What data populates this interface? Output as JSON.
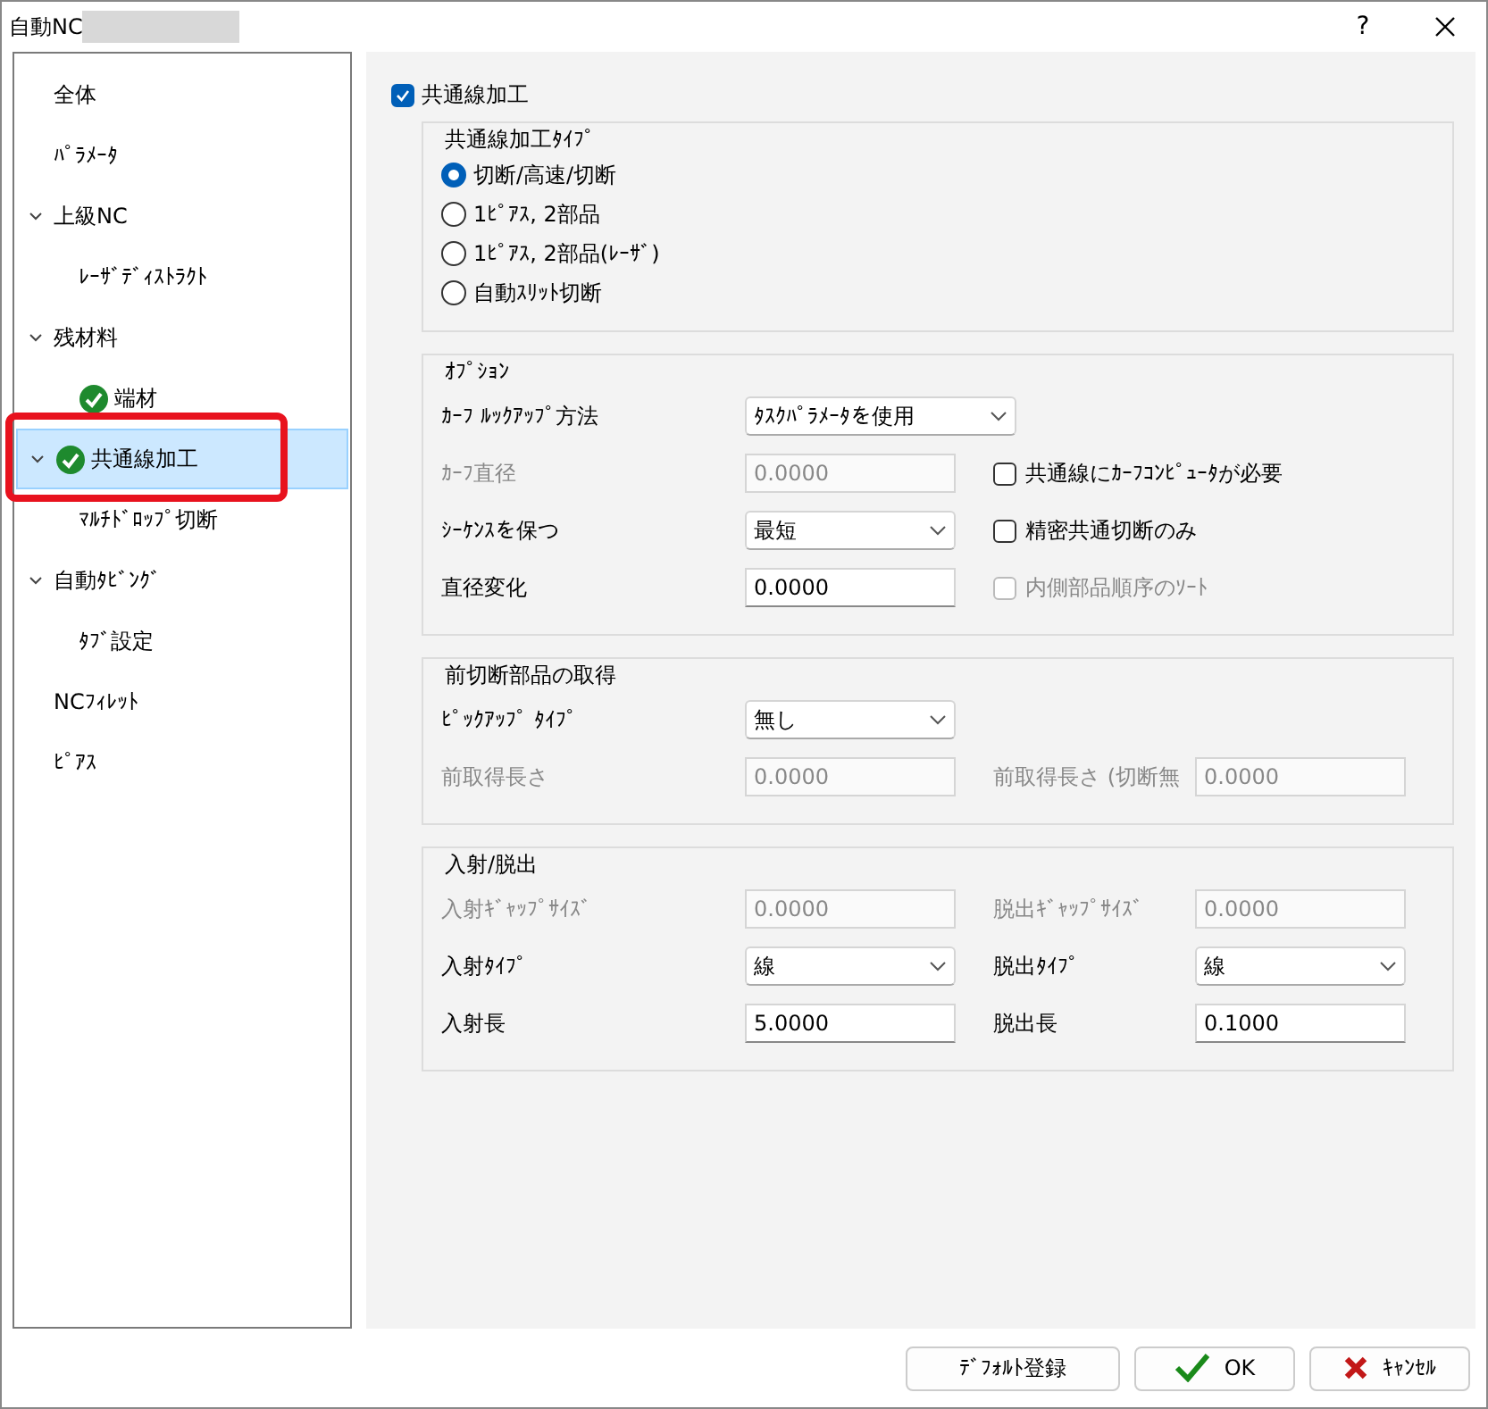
{
  "window": {
    "title": "自動NC",
    "redacted": true,
    "help": "?"
  },
  "tree": [
    {
      "label": "全体",
      "selected": false
    },
    {
      "label": "ﾊﾟﾗﾒｰﾀ",
      "selected": false
    },
    {
      "label": "上級NC",
      "selected": false,
      "expanded": true,
      "children": [
        {
          "label": "ﾚｰｻﾞﾃﾞｨｽﾄﾗｸﾄ",
          "selected": false
        }
      ]
    },
    {
      "label": "残材料",
      "selected": false,
      "expanded": true,
      "children": [
        {
          "label": "端材",
          "selected": false,
          "done": true
        }
      ]
    },
    {
      "label": "共通線加工",
      "selected": true,
      "done": true,
      "annotated": true,
      "expanded": true,
      "children": [
        {
          "label": "ﾏﾙﾁﾄﾞﾛｯﾌﾟ切断",
          "selected": false
        }
      ]
    },
    {
      "label": "自動ﾀﾋﾞﾝｸﾞ",
      "selected": false,
      "expanded": true,
      "children": [
        {
          "label": "ﾀﾌﾞ設定",
          "selected": false
        }
      ]
    },
    {
      "label": "NCﾌｨﾚｯﾄ",
      "selected": false
    },
    {
      "label": "ﾋﾟｱｽ",
      "selected": false
    }
  ],
  "enable": {
    "label": "共通線加工",
    "checked": true
  },
  "groups": [
    {
      "title": "共通線加工ﾀｲﾌﾟ",
      "kind": "radios",
      "options": [
        {
          "label": "切断/高速/切断",
          "selected": true
        },
        {
          "label": "1ﾋﾟｱｽ, 2部品",
          "selected": false
        },
        {
          "label": "1ﾋﾟｱｽ, 2部品(ﾚｰｻﾞ)",
          "selected": false
        },
        {
          "label": "自動ｽﾘｯﾄ切断",
          "selected": false
        }
      ]
    },
    {
      "title": "ｵﾌﾟｼｮﾝ",
      "kind": "form",
      "rows": [
        [
          {
            "kind": "select",
            "label": "ｶｰﾌ ﾙｯｸｱｯﾌﾟ方法",
            "value": "ﾀｽｸﾊﾟﾗﾒｰﾀを使用",
            "disabled": false
          }
        ],
        [
          {
            "kind": "input",
            "label": "ｶｰﾌ直径",
            "value": "0.0000",
            "disabled": true
          },
          {
            "kind": "checkbox",
            "label": "共通線にｶｰﾌｺﾝﾋﾟｭｰﾀが必要",
            "checked": false,
            "disabled": false
          }
        ],
        [
          {
            "kind": "select",
            "label": "ｼｰｹﾝｽを保つ",
            "value": "最短",
            "disabled": false
          },
          {
            "kind": "checkbox",
            "label": "精密共通切断のみ",
            "checked": false,
            "disabled": false
          }
        ],
        [
          {
            "kind": "input",
            "label": "直径変化",
            "value": "0.0000",
            "disabled": false
          },
          {
            "kind": "checkbox",
            "label": "内側部品順序のｿｰﾄ",
            "checked": false,
            "disabled": true
          }
        ]
      ]
    },
    {
      "title": "前切断部品の取得",
      "kind": "form",
      "rows": [
        [
          {
            "kind": "select",
            "label": "ﾋﾟｯｸｱｯﾌﾟ ﾀｲﾌﾟ",
            "value": "無し",
            "disabled": false
          }
        ],
        [
          {
            "kind": "input",
            "label": "前取得長さ",
            "value": "0.0000",
            "disabled": true
          },
          {
            "kind": "input",
            "label": "前取得長さ (切断無",
            "value": "0.0000",
            "disabled": true
          }
        ]
      ]
    },
    {
      "title": "入射/脱出",
      "kind": "form",
      "rows": [
        [
          {
            "kind": "input",
            "label": "入射ｷﾞｬｯﾌﾟｻｲｽﾞ",
            "value": "0.0000",
            "disabled": true
          },
          {
            "kind": "input",
            "label": "脱出ｷﾞｬｯﾌﾟｻｲｽﾞ",
            "value": "0.0000",
            "disabled": true
          }
        ],
        [
          {
            "kind": "select",
            "label": "入射ﾀｲﾌﾟ",
            "value": "線",
            "disabled": false
          },
          {
            "kind": "select",
            "label": "脱出ﾀｲﾌﾟ",
            "value": "線",
            "disabled": false
          }
        ],
        [
          {
            "kind": "input",
            "label": "入射長",
            "value": "5.0000",
            "disabled": false
          },
          {
            "kind": "input",
            "label": "脱出長",
            "value": "0.1000",
            "disabled": false
          }
        ]
      ]
    }
  ],
  "buttons": [
    {
      "label": "ﾃﾞﾌｫﾙﾄ登録",
      "kind": "plain"
    },
    {
      "label": "OK",
      "kind": "ok"
    },
    {
      "label": "ｷｬﾝｾﾙ",
      "kind": "cancel"
    }
  ]
}
